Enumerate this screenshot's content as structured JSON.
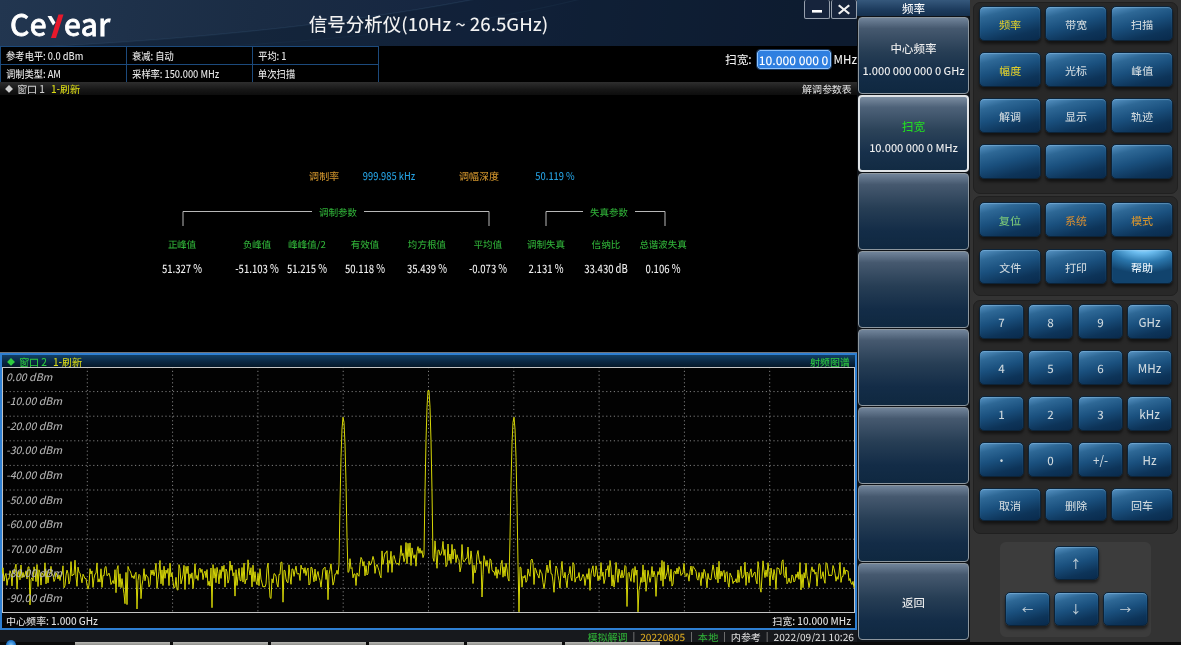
{
  "window": {
    "logo": "Ceyear",
    "title": "信号分析仪(10Hz ~ 26.5GHz)"
  },
  "status_table": {
    "rows": [
      [
        {
          "name": "ref-level",
          "text": "参考电平: 0.0 dBm"
        },
        {
          "name": "attenuation",
          "text": "衰减: 自动"
        },
        {
          "name": "average",
          "text": "平均: 1"
        }
      ],
      [
        {
          "name": "mod-type",
          "text": "调制类型: AM"
        },
        {
          "name": "sample-rate",
          "text": "采样率: 150.000 MHz"
        },
        {
          "name": "sweep-mode",
          "text": "单次扫描"
        }
      ]
    ]
  },
  "span_entry": {
    "label": "扫宽:",
    "value": "10.000 000 0",
    "unit": "MHz"
  },
  "window1": {
    "marker": "◆",
    "title": "窗口 1",
    "refresh": "1-刷新",
    "view_label": "解调参数表",
    "metrics": [
      {
        "label": "调制率",
        "value": "999.985 kHz"
      },
      {
        "label": "调幅深度",
        "value": "50.119 %"
      }
    ],
    "groups": [
      {
        "label": "调制参数"
      },
      {
        "label": "失真参数"
      }
    ],
    "columns": [
      {
        "header": "正峰值",
        "value": "51.327 %"
      },
      {
        "header": "负峰值",
        "value": "-51.103 %"
      },
      {
        "header": "峰峰值/2",
        "value": "51.215 %"
      },
      {
        "header": "有效值",
        "value": "50.118 %"
      },
      {
        "header": "均方根值",
        "value": "35.439 %"
      },
      {
        "header": "平均值",
        "value": "-0.073 %"
      },
      {
        "header": "调制失真",
        "value": "2.131 %"
      },
      {
        "header": "信纳比",
        "value": "33.430 dB"
      },
      {
        "header": "总谐波失真",
        "value": "0.106 %"
      }
    ]
  },
  "window2": {
    "marker": "◆",
    "title": "窗口 2",
    "refresh": "1-刷新",
    "view_label": "射频图谱",
    "footer_left": "中心频率: 1.000 GHz",
    "footer_right": "扫宽: 10.000 MHz"
  },
  "status_bar": {
    "separator": "|",
    "segments": [
      {
        "name": "demod-mode",
        "text": "模拟解调",
        "color": "#2fae37"
      },
      {
        "name": "firmware-date",
        "text": "20220805",
        "color": "#d9a821"
      },
      {
        "name": "control-local",
        "text": "本地",
        "color": "#2fae37"
      },
      {
        "name": "reference-source",
        "text": "内参考",
        "color": "#d8d8d8"
      },
      {
        "name": "datetime",
        "text": "2022/09/21 10:26",
        "color": "#d8d8d8"
      }
    ]
  },
  "softmenu": {
    "header": "频率",
    "buttons": [
      {
        "name": "center-frequency",
        "label": "中心频率",
        "value": "1.000 000 000 0 GHz",
        "state": "normal"
      },
      {
        "name": "span",
        "label": "扫宽",
        "value": "10.000 000 0 MHz",
        "state": "selected"
      },
      {
        "name": "blank-1",
        "label": "",
        "value": "",
        "state": "normal"
      },
      {
        "name": "blank-2",
        "label": "",
        "value": "",
        "state": "normal"
      },
      {
        "name": "blank-3",
        "label": "",
        "value": "",
        "state": "normal"
      },
      {
        "name": "blank-4",
        "label": "",
        "value": "",
        "state": "normal"
      },
      {
        "name": "blank-5",
        "label": "",
        "value": "",
        "state": "normal"
      },
      {
        "name": "back",
        "label": "返回",
        "value": "",
        "state": "normal"
      }
    ]
  },
  "keypad": {
    "function_keys": [
      {
        "name": "frequency",
        "label": "频率",
        "color": "#d8c92e"
      },
      {
        "name": "bandwidth",
        "label": "带宽",
        "color": "#cdd7dc"
      },
      {
        "name": "sweep",
        "label": "扫描",
        "color": "#cdd7dc"
      },
      {
        "name": "amplitude",
        "label": "幅度",
        "color": "#d8c92e"
      },
      {
        "name": "marker",
        "label": "光标",
        "color": "#cdd7dc"
      },
      {
        "name": "peak",
        "label": "峰值",
        "color": "#cdd7dc"
      },
      {
        "name": "demod",
        "label": "解调",
        "color": "#cdd7dc"
      },
      {
        "name": "display",
        "label": "显示",
        "color": "#cdd7dc"
      },
      {
        "name": "trace",
        "label": "轨迹",
        "color": "#cdd7dc"
      },
      {
        "name": "blank-a",
        "label": "",
        "color": "#cdd7dc"
      },
      {
        "name": "blank-b",
        "label": "",
        "color": "#cdd7dc"
      },
      {
        "name": "blank-c",
        "label": "",
        "color": "#cdd7dc"
      }
    ],
    "system_keys": [
      {
        "name": "reset",
        "label": "复位",
        "color": "#7cc878",
        "state": "normal"
      },
      {
        "name": "system",
        "label": "系统",
        "color": "#d08b33",
        "state": "normal"
      },
      {
        "name": "mode",
        "label": "模式",
        "color": "#d09230",
        "state": "normal"
      },
      {
        "name": "file",
        "label": "文件",
        "color": "#cdd7dc",
        "state": "normal"
      },
      {
        "name": "print",
        "label": "打印",
        "color": "#cdd7dc",
        "state": "normal"
      },
      {
        "name": "help",
        "label": "帮助",
        "color": "#e8f2f8",
        "state": "highlight"
      }
    ],
    "numpad": [
      {
        "name": "digit-7",
        "label": "7"
      },
      {
        "name": "digit-8",
        "label": "8"
      },
      {
        "name": "digit-9",
        "label": "9"
      },
      {
        "name": "unit-ghz",
        "label": "GHz"
      },
      {
        "name": "digit-4",
        "label": "4"
      },
      {
        "name": "digit-5",
        "label": "5"
      },
      {
        "name": "digit-6",
        "label": "6"
      },
      {
        "name": "unit-mhz",
        "label": "MHz"
      },
      {
        "name": "digit-1",
        "label": "1"
      },
      {
        "name": "digit-2",
        "label": "2"
      },
      {
        "name": "digit-3",
        "label": "3"
      },
      {
        "name": "unit-khz",
        "label": "kHz"
      },
      {
        "name": "decimal-point",
        "label": "·"
      },
      {
        "name": "digit-0",
        "label": "0"
      },
      {
        "name": "plus-minus",
        "label": "+/-"
      },
      {
        "name": "unit-hz",
        "label": "Hz"
      }
    ],
    "edit_keys": [
      {
        "name": "cancel",
        "label": "取消"
      },
      {
        "name": "delete",
        "label": "删除"
      },
      {
        "name": "enter",
        "label": "回车"
      }
    ],
    "arrow_keys": [
      {
        "name": "arrow-up",
        "label": "↑"
      },
      {
        "name": "arrow-left",
        "label": "←"
      },
      {
        "name": "arrow-down",
        "label": "↓"
      },
      {
        "name": "arrow-right",
        "label": "→"
      }
    ]
  },
  "chart_data": {
    "type": "line",
    "title": "射频图谱",
    "x_center": "1.000 GHz",
    "x_span": "10.000 MHz",
    "x_divisions": 10,
    "y_ticks": [
      "0.00 dBm",
      "-10.00 dBm",
      "-20.00 dBm",
      "-30.00 dBm",
      "-40.00 dBm",
      "-50.00 dBm",
      "-60.00 dBm",
      "-70.00 dBm",
      "-80.00 dBm",
      "-90.00 dBm"
    ],
    "ylim": [
      -100,
      0
    ],
    "grid": true,
    "trace_color": "#d6d606",
    "noise_floor_dbm": -84.5,
    "noise_spread_db": 6.5,
    "center_skirt_db": 9,
    "peaks": [
      {
        "x_div": 4,
        "dbm": -20.3,
        "label": "lower-sideband"
      },
      {
        "x_div": 5,
        "dbm": -8.7,
        "label": "carrier"
      },
      {
        "x_div": 6,
        "dbm": -20.3,
        "label": "upper-sideband"
      }
    ],
    "seed": 11
  }
}
